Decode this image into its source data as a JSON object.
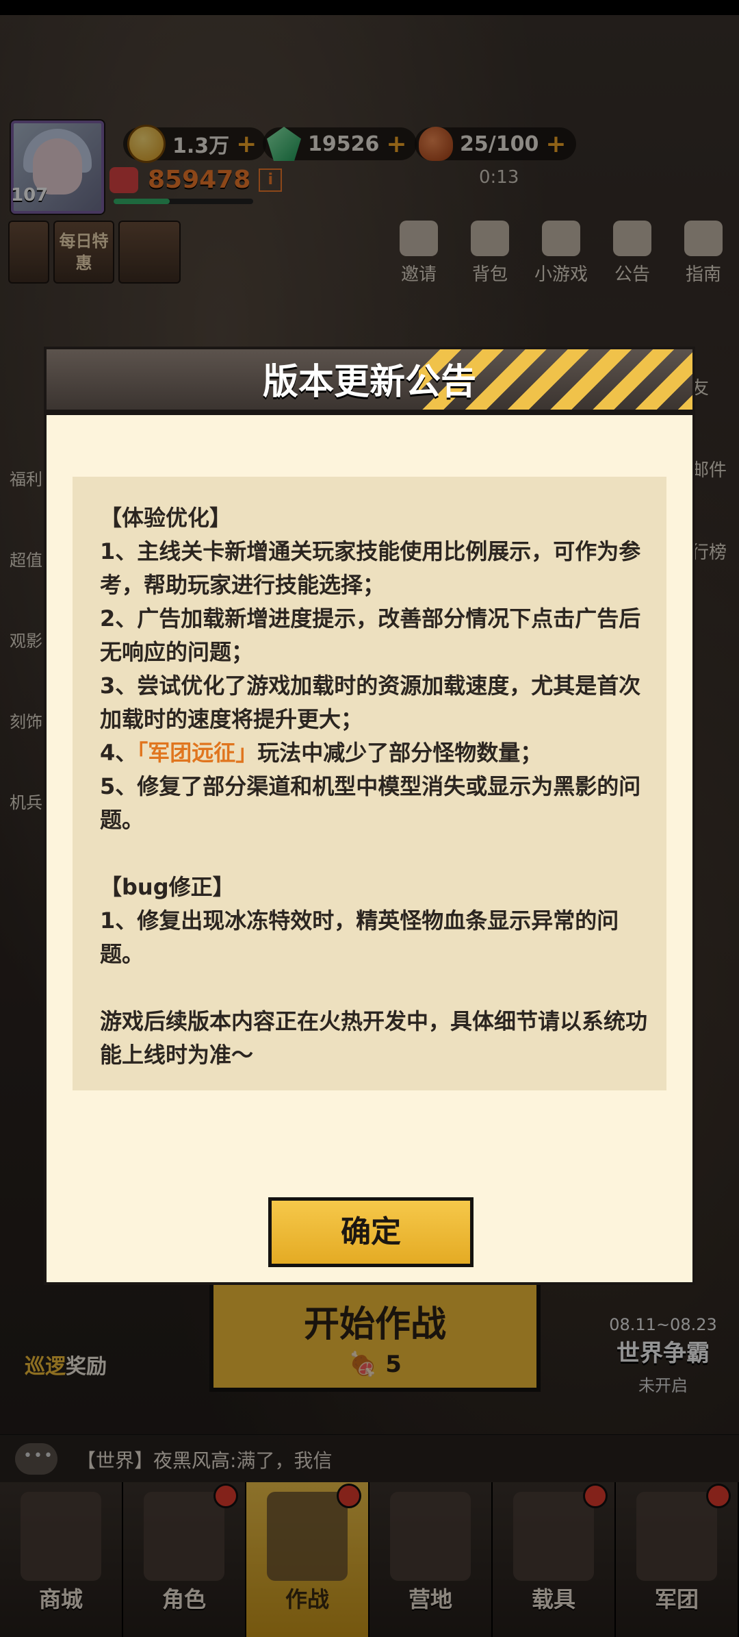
{
  "hud": {
    "level": "107",
    "gold": "1.3万",
    "gems": "19526",
    "stamina": "25/100",
    "timer": "0:13",
    "power": "859478",
    "daily_special": "每日特惠"
  },
  "top_menu": [
    {
      "label": "邀请",
      "icon": "invite-icon"
    },
    {
      "label": "背包",
      "icon": "backpack-icon"
    },
    {
      "label": "小游戏",
      "icon": "gamepad-icon"
    },
    {
      "label": "公告",
      "icon": "megaphone-icon"
    },
    {
      "label": "指南",
      "icon": "guide-icon"
    }
  ],
  "side_left": [
    "福利",
    "超值",
    "观影",
    "刻饰",
    "机兵"
  ],
  "side_right": [
    "友",
    "邮件",
    "行榜"
  ],
  "main": {
    "start_label": "开始作战",
    "start_cost": "5",
    "patrol_a": "巡逻",
    "patrol_b": "奖励",
    "world_dates": "08.11~08.23",
    "world_title": "世界争霸",
    "world_status": "未开启"
  },
  "chat": {
    "channel": "【世界】",
    "name": "夜黑风高",
    "message": ":满了，我信"
  },
  "bottom_nav": [
    {
      "label": "商城",
      "icon": "cart-icon",
      "badge": false,
      "active": false
    },
    {
      "label": "角色",
      "icon": "character-icon",
      "badge": true,
      "active": false
    },
    {
      "label": "作战",
      "icon": "battle-icon",
      "badge": true,
      "active": true
    },
    {
      "label": "营地",
      "icon": "camp-icon",
      "badge": false,
      "active": false
    },
    {
      "label": "载具",
      "icon": "vehicle-icon",
      "badge": true,
      "active": false
    },
    {
      "label": "军团",
      "icon": "legion-icon",
      "badge": true,
      "active": false
    }
  ],
  "modal": {
    "title": "版本更新公告",
    "confirm_label": "确定",
    "sections": {
      "h1": "【体验优化】",
      "l1": "1、主线关卡新增通关玩家技能使用比例展示，可作为参考，帮助玩家进行技能选择；",
      "l2": "2、广告加载新增进度提示，改善部分情况下点击广告后无响应的问题；",
      "l3": "3、尝试优化了游戏加载时的资源加载速度，尤其是首次加载时的速度将提升更大；",
      "l4_pre": "4、",
      "l4_hl": "「军团远征」",
      "l4_post": "玩法中减少了部分怪物数量；",
      "l5": "5、修复了部分渠道和机型中模型消失或显示为黑影的问题。",
      "h2": "【bug修正】",
      "b1": "1、修复出现冰冻特效时，精英怪物血条显示异常的问题。",
      "footer": "游戏后续版本内容正在火热开发中，具体细节请以系统功能上线时为准～"
    }
  }
}
